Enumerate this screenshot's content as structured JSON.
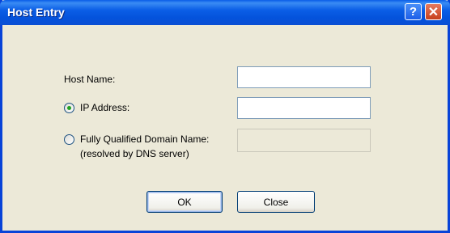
{
  "window": {
    "title": "Host Entry",
    "help_glyph": "?",
    "close_glyph": "✕"
  },
  "form": {
    "host_name": {
      "label": "Host Name:",
      "value": ""
    },
    "ip_address": {
      "label": "IP Address:",
      "value": "",
      "selected": true
    },
    "fqdn": {
      "label": "Fully Qualified Domain Name:",
      "sublabel": "(resolved by DNS server)",
      "value": "",
      "selected": false,
      "disabled": true
    }
  },
  "buttons": {
    "ok_label": "OK",
    "close_label": "Close"
  },
  "colors": {
    "titlebar": "#0a5de8",
    "frame": "#0843d8",
    "dialog_bg": "#ece9d8",
    "radio_dot": "#21a121"
  },
  "icons": [
    "help-icon",
    "close-icon"
  ]
}
